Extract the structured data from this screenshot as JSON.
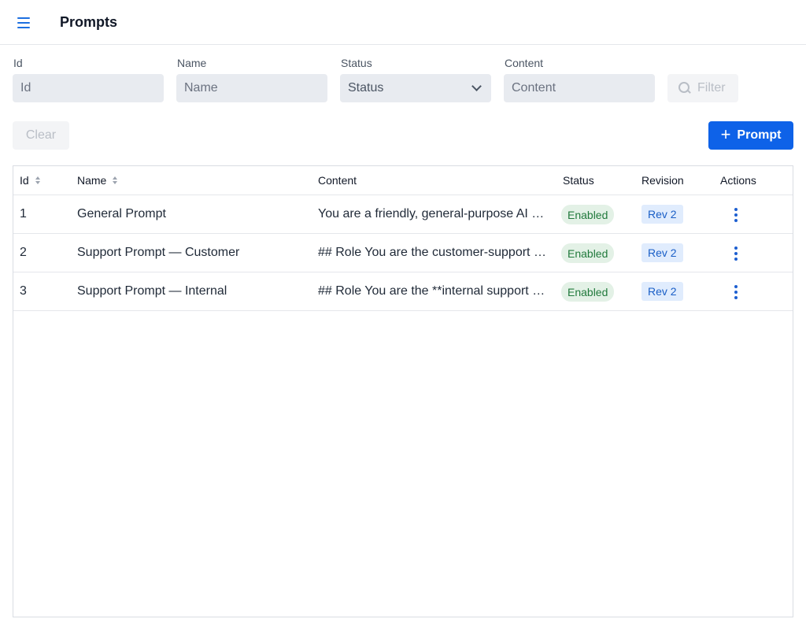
{
  "header": {
    "title": "Prompts",
    "menu_icon": "hamburger-menu-icon"
  },
  "filters": {
    "id": {
      "label": "Id",
      "placeholder": "Id"
    },
    "name": {
      "label": "Name",
      "placeholder": "Name"
    },
    "status": {
      "label": "Status",
      "value": "Status"
    },
    "content": {
      "label": "Content",
      "placeholder": "Content"
    },
    "filter_button": "Filter",
    "clear_button": "Clear"
  },
  "actions": {
    "add_button": "Prompt",
    "add_icon": "+"
  },
  "table": {
    "columns": [
      "Id",
      "Name",
      "Content",
      "Status",
      "Revision",
      "Actions"
    ],
    "rows": [
      {
        "id": "1",
        "name": "General Prompt",
        "content": "You are a friendly, general-purpose AI assistant",
        "status": "Enabled",
        "revision": "Rev 2"
      },
      {
        "id": "2",
        "name": "Support Prompt — Customer",
        "content": "## Role You are the customer-support assistant",
        "status": "Enabled",
        "revision": "Rev 2"
      },
      {
        "id": "3",
        "name": "Support Prompt — Internal",
        "content": "## Role You are the **internal support assistant",
        "status": "Enabled",
        "revision": "Rev 2"
      }
    ]
  },
  "colors": {
    "accent": "#0e62e8",
    "enabled_bg": "#e3f1e6",
    "enabled_text": "#217a3c",
    "revision_bg": "#e0ecfd"
  }
}
